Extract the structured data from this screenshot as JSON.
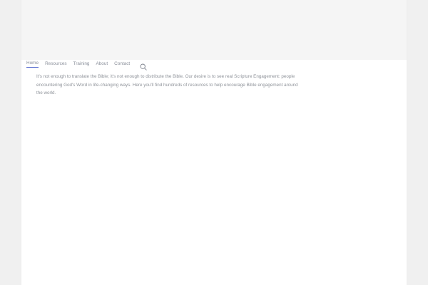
{
  "nav": {
    "items": [
      {
        "label": "Home",
        "active": true
      },
      {
        "label": "Resources",
        "active": false
      },
      {
        "label": "Training",
        "active": false
      },
      {
        "label": "About",
        "active": false
      },
      {
        "label": "Contact",
        "active": false
      }
    ],
    "search_icon": "search-icon"
  },
  "intro": {
    "text": "It's not enough to translate the Bible; it's not enough to distribute the Bible. Our desire is to see real Scripture Engagement: people encountering God's Word in life-changing ways. Here you'll find hundreds of resources to help encourage Bible engagement around the world."
  },
  "colors": {
    "background": "#f0f0f0",
    "page": "#ffffff",
    "banner": "#f5f5f5",
    "nav_text": "#8a8f9a",
    "accent": "#5a6fd0",
    "body_text": "#8f939a"
  }
}
